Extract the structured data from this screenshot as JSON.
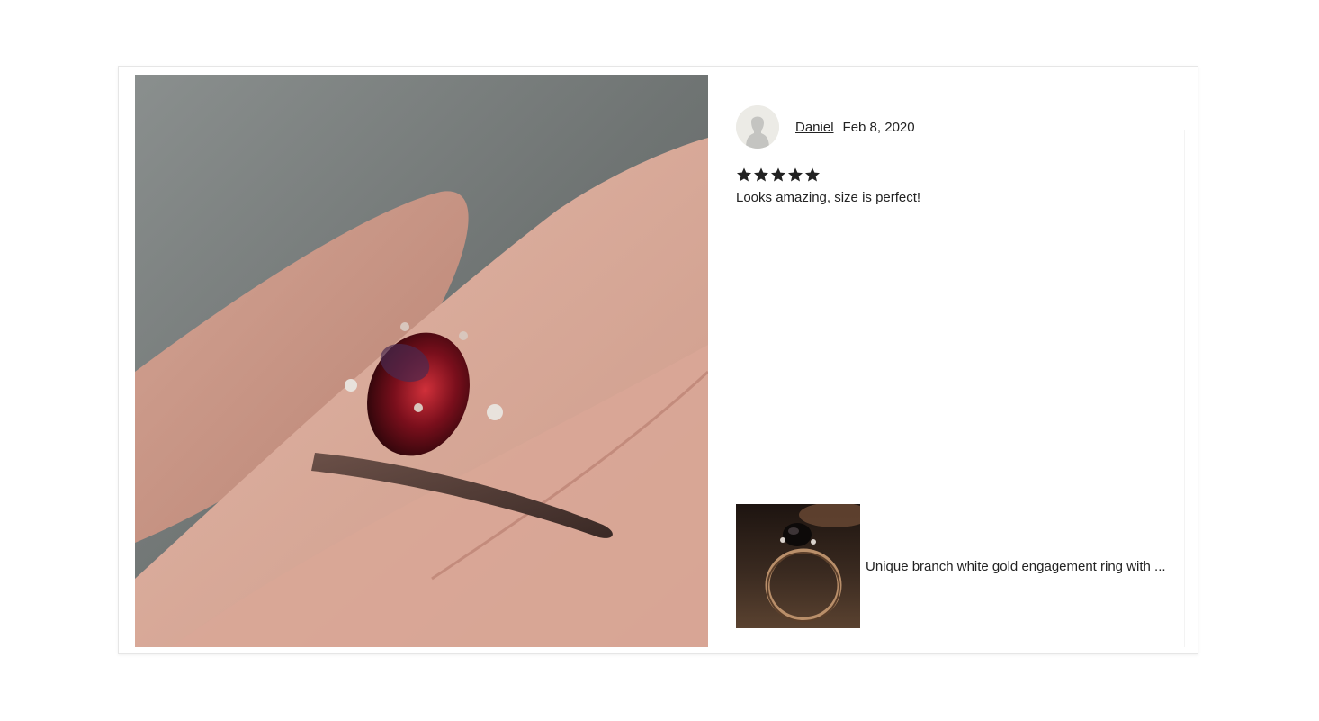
{
  "review": {
    "reviewer_name": "Daniel",
    "date": "Feb 8, 2020",
    "rating": 5,
    "rating_max": 5,
    "text": "Looks amazing, size is perfect!"
  },
  "item": {
    "title": "Unique branch white gold engagement ring with ..."
  },
  "icons": {
    "avatar": "default-user-avatar-icon",
    "star": "star-icon"
  },
  "colors": {
    "text": "#222222",
    "star": "#222222",
    "border": "#e6e6e6",
    "avatar_bg": "#ecebe6"
  }
}
